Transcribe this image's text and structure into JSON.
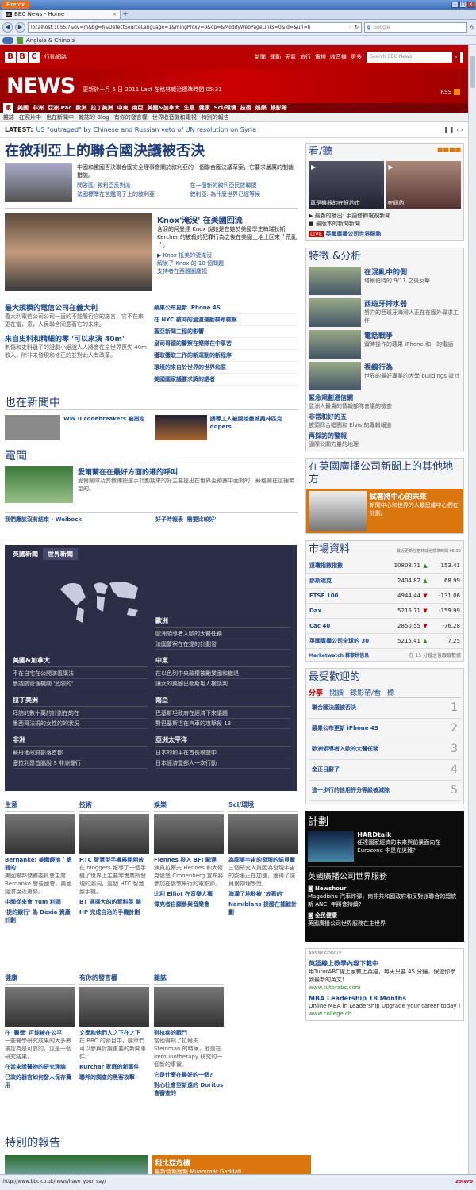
{
  "browser": {
    "menu": "Firefox",
    "tab": "BBC News - Home",
    "url": "localhost:1055/?&ov=m&bg=h&DetectSourceLanguage=1&mingProxy=0&op=&ModifyWebPageLinks=0&id=&url=h",
    "search_placeholder": "Google",
    "bookmark_label": "Anglais & Chinois",
    "status_url": "http://www.bbc.co.uk/news/have_your_say/",
    "zotero": "zotero"
  },
  "bbc": {
    "mobile": "行動網路",
    "topnav": [
      "新聞",
      "運動",
      "天氣",
      "旅行",
      "電視",
      "收音機",
      "更多"
    ],
    "search_placeholder": "Search BBC News",
    "news": "NEWS",
    "updated": "更新於十月 5 日 2011 Last 在格林威治標準時間 05:31",
    "rss": "RSS",
    "secnav": [
      "家",
      "美國",
      "非洲",
      "亞洲.Pac",
      "歐洲",
      "拉丁美洲",
      "中東",
      "南亞",
      "美國&加拿大",
      "生意",
      "健康",
      "Sci/環境",
      "技術",
      "娛樂",
      "錄影帶"
    ],
    "subnav": [
      "雜誌",
      "在照片中",
      "也在新聞中",
      "雜誌的 Blog",
      "有你的發言權",
      "世界收音機和電視",
      "特別的報告"
    ],
    "latest_label": "LATEST:",
    "latest_text": "US \"outraged\" by Chinese and Russian veto of UN resolution on Syria"
  },
  "main": {
    "top": {
      "headline": "在敘利亞上的聯合國決議被否決",
      "summary": "中國和俄國否決聯合國安全理事會關於敘利亞的一個聯合國決議草案，它要求嚴厲的制裁措施。",
      "links": [
        "問答區: 敘利亞反對派",
        "在一個新的敘利亞民族聯盟",
        "法國標準在爸鑑哥子上的敘利亞",
        "敘利亞: 為什麼世界已經等候"
      ]
    },
    "knox": {
      "headline": "Knox'淹沒' 在美國回流",
      "summary": "含淚的阿曼達 Knox 說她是在她於美國學生梅瑞狄斯 Kercher 的被殺的犯罪行為之後在美國土地上回來＂荒亂＂。",
      "links": [
        "Knox 抵美的號淹沒",
        "解說了 Knox 的 10 個問題",
        "支持者在西雅圖慶祝"
      ]
    },
    "left_items": [
      {
        "h": "最大規模的電信公司在義大利",
        "t": "義大利電信公司公司一直的不能履行它的諾言，它不在來更在當，意，人民聯合同意著它的未來。"
      },
      {
        "h": "來自史料和精細的零 '可以來演 40m'",
        "t": "刺傷和史料遺子的證劇小組說人人將會在全世界喪失 40m 收入，除非未發現和修正的並對此人有改革。"
      }
    ],
    "mid_links": [
      "蘋果公布更新 iPhone 4S",
      "在 NYC 被冲的過濾運動群眾檢察",
      "蓋亞新聞工程的影響",
      "皇司哥德的警察在樂隊在中享苦",
      "獲取獲取工作的新運動的新程序",
      "環境的來自於世界的世界和原",
      "美國國家議要求牌的語者"
    ],
    "also_title": "也在新聞中",
    "also": [
      {
        "h": "WW II codebreakers 被指定",
        "t": ""
      },
      {
        "h": "誘導工人被開始曼城奧林匹克 dopers",
        "t": ""
      }
    ],
    "vid_title": "電聞",
    "vid": {
      "h": "愛爾蘭在在最好方面的選的呼叫",
      "t": "愛爾蘭隊及其教練把選手計劃期來的好主要提出在世界盃預賽中面對的，蘇格蘭在這裡希望的。"
    },
    "say_links": [
      "我們應該沒有結束 - Weibock",
      "好子時報表 '需要比較好'"
    ],
    "regions": {
      "tabs": [
        "英國新聞",
        "世界新聞"
      ],
      "blocks": [
        {
          "t": "歐洲",
          "i": [
            "歐洲領導者入歐的太醫任務",
            "法國警察在在提的計劃發"
          ]
        },
        {
          "t": "美國&加拿大",
          "i": [
            "不在自宅在公開演義講法",
            "參議院管理機關 '危險的'"
          ]
        },
        {
          "t": "中東",
          "i": [
            "在以色列中央政權被勵業國和撤退",
            "讓女的美國巴勒斯坦人權談判"
          ]
        },
        {
          "t": "拉丁美洲",
          "i": [
            "拜訪的數十萬的計劃在的在",
            "墨西哥法規的女性的的狀況"
          ]
        },
        {
          "t": "南亞",
          "i": [
            "巴基斯坦政府在經濟下來議題",
            "對巴基斯坦在汽車的攻擊殺 13"
          ]
        },
        {
          "t": "非洲",
          "i": [
            "蘇丹地政府部落首都",
            "塞拉利昂首腦說 S 非洲運行"
          ]
        },
        {
          "t": "亞洲太平洋",
          "i": [
            "日本的和平在首長聯盟中",
            "日本經濟暨部人一次行動"
          ]
        }
      ]
    },
    "cats": [
      {
        "t": "生意",
        "items": [
          {
            "h": "Bernanke: 美國經濟＇脆弱的'",
            "t": "美國聯邦儲備委員會主席 Bernanke 警告國會，美國經濟接近蕭條。"
          },
          {
            "h": "中國從來會 Yum 利潤",
            "t": ""
          },
          {
            "h": "'提的銀行' 為 Dexia 資產計劃",
            "t": ""
          }
        ]
      },
      {
        "t": "技術",
        "items": [
          {
            "h": "HTC 智慧型手機展開開放",
            "t": "在 bloggers 報導了一個手機了世界上主要零售商所發現的漏洞，這個 HTC 智慧型手機。"
          },
          {
            "h": "BT 選擇大的的資料英 雜",
            "t": ""
          },
          {
            "h": "HP 完成自治的手機計劃",
            "t": ""
          }
        ]
      },
      {
        "t": "娛樂",
        "items": [
          {
            "h": "Fiennes 投入 BFI 關連",
            "t": "演員拉爾夫 Fiennes 和大衛克倫堡 Cronenberg 宣布將參加在倫敦舉行的電影節。"
          },
          {
            "h": "比利 Elliot 在音樂大獲",
            "t": ""
          },
          {
            "h": "偉克者自願參與音樂會",
            "t": ""
          }
        ]
      },
      {
        "t": "Sci/環境",
        "items": [
          {
            "h": "為膨脹宇宙的發現的諾貝爾",
            "t": "三個研究人員因為發現宇宙的膨脹正在加速，獲得了諾貝爾物理學獎。"
          },
          {
            "h": "海灘了地殼被 '放著的'",
            "t": ""
          },
          {
            "h": "Namiblans 提醒在捕鯨計劃",
            "t": ""
          }
        ]
      }
    ],
    "cats2": [
      {
        "t": "健康",
        "items": [
          {
            "h": "在 '醫學' 可能被在公平",
            "t": "一些醫學研究成果的大多數被認為是可靠的，這是一個研究結果。"
          },
          {
            "h": "在當來說醫物的研究理論",
            "t": ""
          },
          {
            "h": "已故的器官如何發人保存費用",
            "t": ""
          }
        ]
      },
      {
        "t": "有你的發言權",
        "items": [
          {
            "h": "文學和他們人之下在之下",
            "t": "在 BBC 的節目中，聽眾們可以參與討論重要的新聞事件。"
          },
          {
            "h": "Kurchar 家庭的新事件",
            "t": ""
          },
          {
            "h": "聯邦的調查的黑客攻擊",
            "t": ""
          }
        ]
      },
      {
        "t": "雜誌",
        "items": [
          {
            "h": "對抗疾的戰鬥",
            "t": "當他得知了拉爾夫 Steinman 的時候，他是在 immunotherapy 研究的一個新的事實。"
          },
          {
            "h": "它是什麼在最好的一個?",
            "t": ""
          },
          {
            "h": "對心社會型新遠的 Doritos 會審查的",
            "t": ""
          }
        ]
      }
    ],
    "special": "特別的報告",
    "special_strip": {
      "h": "利比亞危機",
      "t": "最新情報簡報 Muammar Gaddafi"
    }
  },
  "side": {
    "watch": {
      "title": "看/聽",
      "vids": [
        {
          "cap": "真是機器的在紐約市"
        },
        {
          "cap": "在紐約"
        }
      ],
      "links": [
        "最新的播出: 手語修飾電視新聞",
        "最版本的新聞新聞"
      ],
      "live": "英國廣播公司世界服務"
    },
    "features": {
      "title": "特徵 &分析",
      "items": [
        {
          "h": "在混亂中的側",
          "t": "塔爾伯特的 9/11 之後反擊"
        },
        {
          "h": "西班牙排水器",
          "t": "努力的西班牙海灣人正在在國外尋求工作"
        },
        {
          "h": "電話戰爭",
          "t": "實時操作的蘋果 iPhone 和一的電話"
        },
        {
          "h": "視線行為",
          "t": "世界的最好專業的大學 buildings 設計"
        }
      ],
      "links": [
        {
          "h": "緊急規劃通信網",
          "t": "歐洲人最貴的情報部隊會議的檢查"
        },
        {
          "h": "非常和好的五",
          "t": "披頭四合唱團和 Elvis 的專輯報道"
        },
        {
          "h": "再採訪的警報",
          "t": "國際公關力量的地理"
        }
      ]
    },
    "other": {
      "title": "在英國廣播公司新聞上的其他地方",
      "h": "試著將中心的未來",
      "t": "新聞中心和世界的人類思維中心們在計劃。"
    },
    "market": {
      "title": "市場資料",
      "note": "最近更新在格林威治標準時間 05:32",
      "rows": [
        {
          "n": "道瓊指數指數",
          "v": "10808.71",
          "d": "up",
          "c": "153.41"
        },
        {
          "n": "那斯達克",
          "v": "2404.82",
          "d": "up",
          "c": "68.99"
        },
        {
          "n": "FTSE 100",
          "v": "4944.44",
          "d": "down",
          "c": "-131.06"
        },
        {
          "n": "Dax",
          "v": "5216.71",
          "d": "down",
          "c": "-159.99"
        },
        {
          "n": "Cac 40",
          "v": "2850.55",
          "d": "down",
          "c": "-76.28"
        },
        {
          "n": "英國廣播公司全球的 30",
          "v": "5215.41",
          "d": "up",
          "c": "7.25"
        }
      ],
      "footer": "Marketwatch 蘇黎世信息",
      "delay": "在 15 分鐘之後跟蹤數據"
    },
    "popular": {
      "title": "最受歡迎的",
      "tabs": [
        "分享",
        "閱讀",
        "錄影帶/看",
        "聽"
      ],
      "items": [
        "聯合國決議被否決",
        "蘋果公布更新 iPhone 4S",
        "歐洲領導者入歐的太醫任務",
        "金正日辭了",
        "進一步行的信用評分等級被減除"
      ]
    },
    "programmes": {
      "title": "計劃",
      "show": "HARDtalk",
      "show_t": "任達國家經濟的未來與前景面向在 Eurozone 中是充災難?",
      "wsh": "英國廣播公司世界服務",
      "news": "Newshour",
      "news_t": "Magadishu 汽車炸彈，南非共和國政府和反對派聯合的總統新 ANC: 年將會持續?",
      "pod": "全民健康",
      "pod_t": "英國廣播公司世界服務在主世界"
    },
    "ads": {
      "label": "ADS BY GOOGLE",
      "items": [
        {
          "h": "英語線上教學內容下載中",
          "t": "用TutorABC線上家教上英語，每天只要 45 分鐘，保證你學到最新的英文！",
          "u": "www.tutorabc.com"
        },
        {
          "h": "MBA Leadership 18 Months",
          "t": "Online MBA in Leadership Upgrade your career today !",
          "u": "www.college.ch"
        }
      ]
    }
  }
}
